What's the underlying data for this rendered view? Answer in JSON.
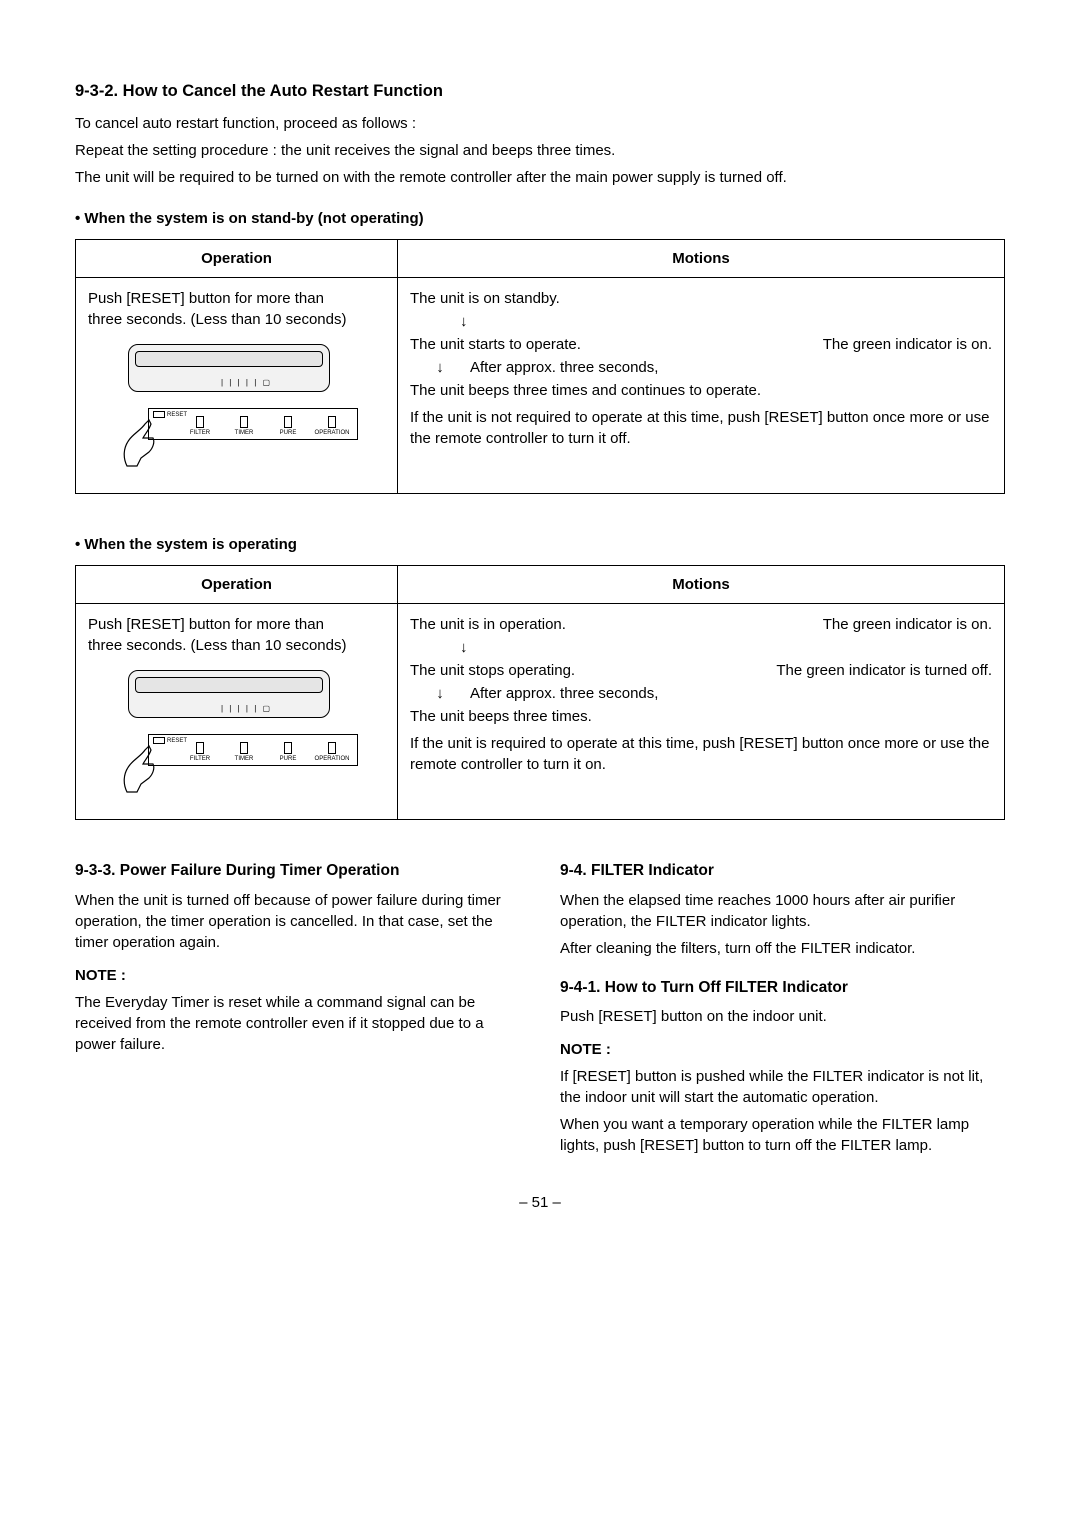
{
  "s932": {
    "heading": "9-3-2.  How to Cancel the Auto Restart Function",
    "p1": "To cancel auto restart function, proceed as follows :",
    "p2": "Repeat the setting procedure : the unit receives the signal and beeps three times.",
    "p3": "The unit will be required to be turned on with the remote controller after the main power supply is turned off.",
    "bullet_standby": "When the system is on stand-by (not operating)",
    "bullet_operating": "When the system is operating",
    "th_operation": "Operation",
    "th_motions": "Motions",
    "op_text1": "Push [RESET] button for more than",
    "op_text2": "three seconds. (Less than 10 seconds)",
    "standby": {
      "m1": "The unit is on standby.",
      "m2a": "The unit starts to operate.",
      "m2b": "The green indicator is on.",
      "m3": "After approx. three seconds,",
      "m4": "The unit beeps three times and continues to operate.",
      "m5": "If the unit is not required to operate at this time, push [RESET] button once more or use the remote controller to turn it off."
    },
    "operating": {
      "m1a": "The unit is in operation.",
      "m1b": "The green indicator is on.",
      "m2a": "The unit stops operating.",
      "m2b": "The green indicator is turned off.",
      "m3": "After approx. three seconds,",
      "m4": "The unit beeps three times.",
      "m5": "If the unit is required to operate at this time, push [RESET] button once more or use the remote controller to turn it on."
    },
    "panel_labels": {
      "reset": "RESET",
      "filter": "FILTER",
      "timer": "TIMER",
      "pure": "PURE",
      "operation": "OPERATION"
    }
  },
  "s933": {
    "heading": "9-3-3.  Power Failure During Timer Operation",
    "p1": "When the unit is turned off because of power failure during timer operation, the timer operation is cancelled.  In that case, set the timer operation again.",
    "note_label": "NOTE :",
    "note_p1": "The Everyday Timer is reset while a command signal can be received from the remote controller even if it stopped due to a power failure."
  },
  "s94": {
    "heading": "9-4.  FILTER Indicator",
    "p1": "When the elapsed time reaches 1000 hours after air purifier operation, the FILTER indicator lights.",
    "p2": "After cleaning the filters, turn off the FILTER indicator.",
    "s941_heading": "9-4-1.  How to Turn Off FILTER Indicator",
    "s941_p1": "Push [RESET] button on the indoor unit.",
    "note_label": "NOTE :",
    "note_p1": "If [RESET] button is pushed while the FILTER indicator is not lit, the indoor unit will start the automatic operation.",
    "note_p2": "When you want a temporary operation while the FILTER lamp lights, push [RESET] button to turn off the FILTER lamp."
  },
  "page_number": "– 51 –",
  "arrow_glyph": "↓"
}
